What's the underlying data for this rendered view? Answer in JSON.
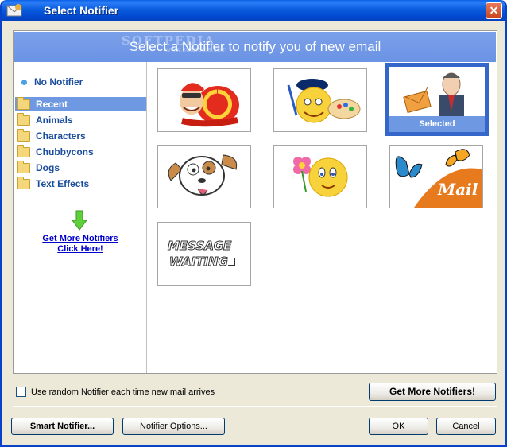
{
  "window": {
    "title": "Select Notifier",
    "close_glyph": "✕"
  },
  "banner": {
    "text": "Select a Notifier to notify you of new email",
    "watermark": "SOFTPEDIA",
    "watermark_sub": "www.softpedia.com"
  },
  "sidebar": {
    "no_notifier": "No Notifier",
    "categories": [
      {
        "label": "Recent",
        "selected": true
      },
      {
        "label": "Animals",
        "selected": false
      },
      {
        "label": "Characters",
        "selected": false
      },
      {
        "label": "Chubbycons",
        "selected": false
      },
      {
        "label": "Dogs",
        "selected": false
      },
      {
        "label": "Text Effects",
        "selected": false
      }
    ],
    "more_link_line1": "Get More Notifiers",
    "more_link_line2": "Click Here!"
  },
  "tiles": [
    {
      "name": "snail-racer",
      "selected": false
    },
    {
      "name": "artist-smiley",
      "selected": false
    },
    {
      "name": "businessman-envelope",
      "selected": true,
      "label": "Selected"
    },
    {
      "name": "cartoon-dog",
      "selected": false
    },
    {
      "name": "flower-smiley",
      "selected": false
    },
    {
      "name": "butterfly-mail",
      "selected": false,
      "overlay_text": "Mail"
    },
    {
      "name": "message-waiting",
      "selected": false,
      "overlay_line1": "MESSAGE",
      "overlay_line2": "WAITING"
    }
  ],
  "options": {
    "random_checkbox_label": "Use random Notifier each time new mail arrives",
    "random_checked": false
  },
  "buttons": {
    "get_more": "Get More Notifiers!",
    "smart_notifier": "Smart Notifier...",
    "notifier_options": "Notifier Options...",
    "ok": "OK",
    "cancel": "Cancel"
  },
  "colors": {
    "titlebar": "#0a5bdd",
    "banner": "#6f98e2",
    "selection": "#3566c9",
    "link": "#0000cc",
    "category_text": "#1a4d9c"
  }
}
